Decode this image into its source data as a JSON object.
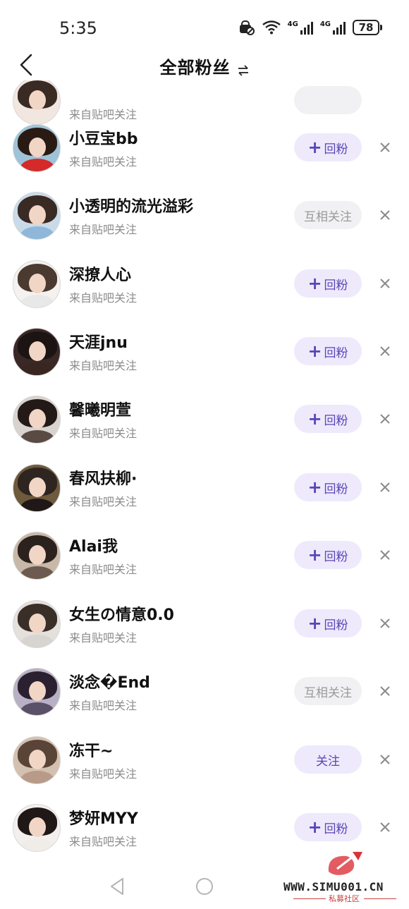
{
  "status_bar": {
    "time": "5:35",
    "signal_labels": [
      "4G",
      "4G"
    ],
    "battery_level": "78"
  },
  "header": {
    "title": "全部粉丝"
  },
  "colors": {
    "accent": "#5a45b8",
    "accent_bg": "#eeeafc",
    "muted_bg": "#f1f1f3",
    "muted_text": "#9a9a9a",
    "secondary_text": "#8c8c8c"
  },
  "followers": [
    {
      "name": "",
      "source": "来自贴吧关注",
      "action": ""
    },
    {
      "name": "小豆宝bb",
      "source": "来自贴吧关注",
      "action": "回粉",
      "action_type": "followback",
      "avatar": {
        "hair": "#2a1a14",
        "body": "#d42a2a"
      }
    },
    {
      "name": "小透明的流光溢彩",
      "source": "来自贴吧关注",
      "action": "互相关注",
      "action_type": "mutual",
      "avatar": {
        "hair": "#3a2a24",
        "body": "#8fb7d9"
      }
    },
    {
      "name": "深撩人心",
      "source": "来自贴吧关注",
      "action": "回粉",
      "action_type": "followback",
      "avatar": {
        "hair": "#4a3a30",
        "body": "#e8e8e8"
      }
    },
    {
      "name": "天涯jnu",
      "source": "来自贴吧关注",
      "action": "回粉",
      "action_type": "followback",
      "avatar": {
        "hair": "#1b1412",
        "body": "#3a2620"
      }
    },
    {
      "name": "馨曦明萱",
      "source": "来自贴吧关注",
      "action": "回粉",
      "action_type": "followback",
      "avatar": {
        "hair": "#231916",
        "body": "#5a4a44"
      }
    },
    {
      "name": "春风扶柳·",
      "source": "来自贴吧关注",
      "action": "回粉",
      "action_type": "followback",
      "avatar": {
        "hair": "#2e2420",
        "body": "#201818"
      }
    },
    {
      "name": "Alai我",
      "source": "来自贴吧关注",
      "action": "回粉",
      "action_type": "followback",
      "avatar": {
        "hair": "#2b211d",
        "body": "#6d5a50"
      }
    },
    {
      "name": "女生の情意0.0",
      "source": "来自贴吧关注",
      "action": "回粉",
      "action_type": "followback",
      "avatar": {
        "hair": "#3a2e28",
        "body": "#d8d4d0"
      }
    },
    {
      "name": "淡念�End",
      "source": "来自贴吧关注",
      "action": "互相关注",
      "action_type": "mutual",
      "avatar": {
        "hair": "#2a2030",
        "body": "#5a5068"
      }
    },
    {
      "name": "冻干~",
      "source": "来自贴吧关注",
      "action": "关注",
      "action_type": "follow",
      "avatar": {
        "hair": "#5a4438",
        "body": "#b89a88"
      }
    },
    {
      "name": "梦妍MYY",
      "source": "来自贴吧关注",
      "action": "回粉",
      "action_type": "followback",
      "avatar": {
        "hair": "#1f1816",
        "body": "#f0ece8"
      }
    }
  ],
  "watermark": {
    "site": "WWW.SIMU001.CN",
    "subtitle": "私募社区"
  }
}
